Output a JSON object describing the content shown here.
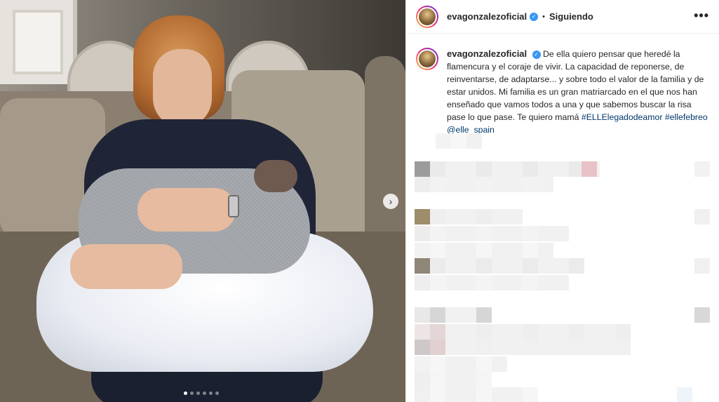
{
  "post": {
    "username": "evagonzalezoficial",
    "verified": true,
    "follow_status": "Siguiendo",
    "more_label": "•••",
    "caption": {
      "username": "evagonzalezoficial",
      "text": "De ella quiero pensar que heredé la flamencura y el coraje de vivir. La capacidad de reponerse, de reinventarse, de adaptarse... y sobre todo el valor de la familia y de estar unidos. Mi familia es un gran matriarcado en el que nos han enseñado que vamos todos a una y que sabemos buscar la risa pase lo que pase. Te quiero mamá",
      "hashtags": [
        "#ELLElegadodeamor",
        "#ellefebreo"
      ],
      "mention": "@elle_spain"
    },
    "carousel": {
      "next_icon": "chevron-right-icon",
      "next_glyph": "›",
      "slide_count": 6,
      "active_slide": 1
    }
  },
  "colors": {
    "verified": "#3897f0",
    "hashtag": "#00376b",
    "text": "#262626"
  }
}
